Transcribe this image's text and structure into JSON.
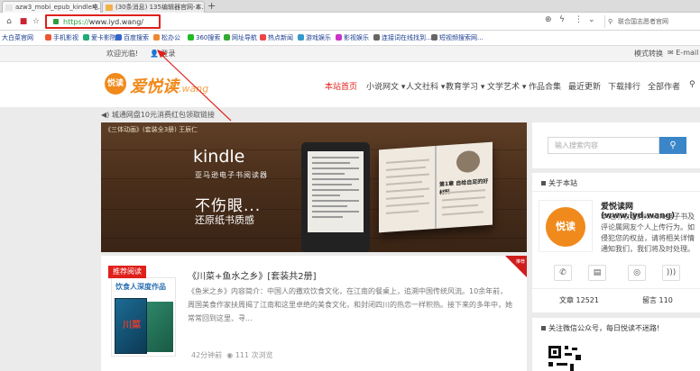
{
  "browser": {
    "tabs": [
      {
        "label": "azw3_mobi_epub_kindle电..."
      },
      {
        "label": "(30条消息) 135编辑器官网-本..."
      }
    ],
    "new_tab": "+",
    "url_scheme": "https://",
    "url_host": "www.iyd.wang/",
    "address_search_placeholder": "联合国志愿者官网",
    "bookmarks": [
      {
        "label": "大白菜官网",
        "color": "#d33"
      },
      {
        "label": "手机影视",
        "color": "#e53"
      },
      {
        "label": "爱卡影院",
        "color": "#2a7"
      },
      {
        "label": "百度搜索",
        "color": "#36c"
      },
      {
        "label": "松办公",
        "color": "#e83"
      },
      {
        "label": "360搜索",
        "color": "#2b2"
      },
      {
        "label": "网址导航",
        "color": "#3a3"
      },
      {
        "label": "热点新闻",
        "color": "#e44"
      },
      {
        "label": "游戏娱乐",
        "color": "#39c"
      },
      {
        "label": "影视娱乐",
        "color": "#c3c"
      },
      {
        "label": "连接词在线找到...",
        "color": "#666"
      },
      {
        "label": "短视频搜索网...",
        "color": "#666"
      }
    ]
  },
  "site": {
    "welcome": "欢迎光临!",
    "login": "登录",
    "mode_switch": "模式转换",
    "email": "E-mail",
    "logo_cn": "爱悦读",
    "logo_en": ".wang",
    "logo_badge": "悦读",
    "nav": [
      {
        "label": "本站首页"
      },
      {
        "label": "小说网文 ▾"
      },
      {
        "label": "人文社科 ▾"
      },
      {
        "label": "教育学习 ▾"
      },
      {
        "label": "文学艺术 ▾"
      },
      {
        "label": "作品合集"
      },
      {
        "label": "最近更新"
      },
      {
        "label": "下载排行"
      },
      {
        "label": "全部作者"
      }
    ],
    "notice": "城通网盘10元消费红包领取链接"
  },
  "banner": {
    "caption": "《三体动画》(套装全3册) 王辰仁",
    "kindle_word": "kindle",
    "kindle_sub": "亚马逊电子书阅读器",
    "slogan1": "不伤眼...",
    "slogan2": "还原纸书质感",
    "book_title": "第1章 自给自足的好材料"
  },
  "post": {
    "tag": "推荐阅读",
    "title": "《川菜+鱼水之乡》[套装共2册]",
    "desc": "《鱼米之乡》内容简介：中国人的撒欢饮食文化，在江南的餐桌上，追溯中国传统风流。10余年前，周国美食作家扶周揭了江南和这里卓绝的美食文化，和封闭四川的热恋一样积热。接下来的多年中，她常常回到这里、寻...",
    "cover_title": "饮食人深度作品",
    "cover_book": "川菜",
    "ribbon": "推荐",
    "read_time": "42分钟前",
    "views": "111 次浏览"
  },
  "sidebar": {
    "search_placeholder": "输入搜索内容",
    "about_title": "关于本站",
    "about_name": "爱悦读网(www.iyd.wang)",
    "about_desc": "本站所收录的kindle电子书及评论属网友个人上传行为。如侵犯您的权益，请将相关详情通知我们，我们将及时处理。",
    "about_logo": "悦读",
    "article_count": "文章 12521",
    "comment_count": "留言 110",
    "wechat_title": "关注微信公众号，每日悦读不迷路!"
  }
}
